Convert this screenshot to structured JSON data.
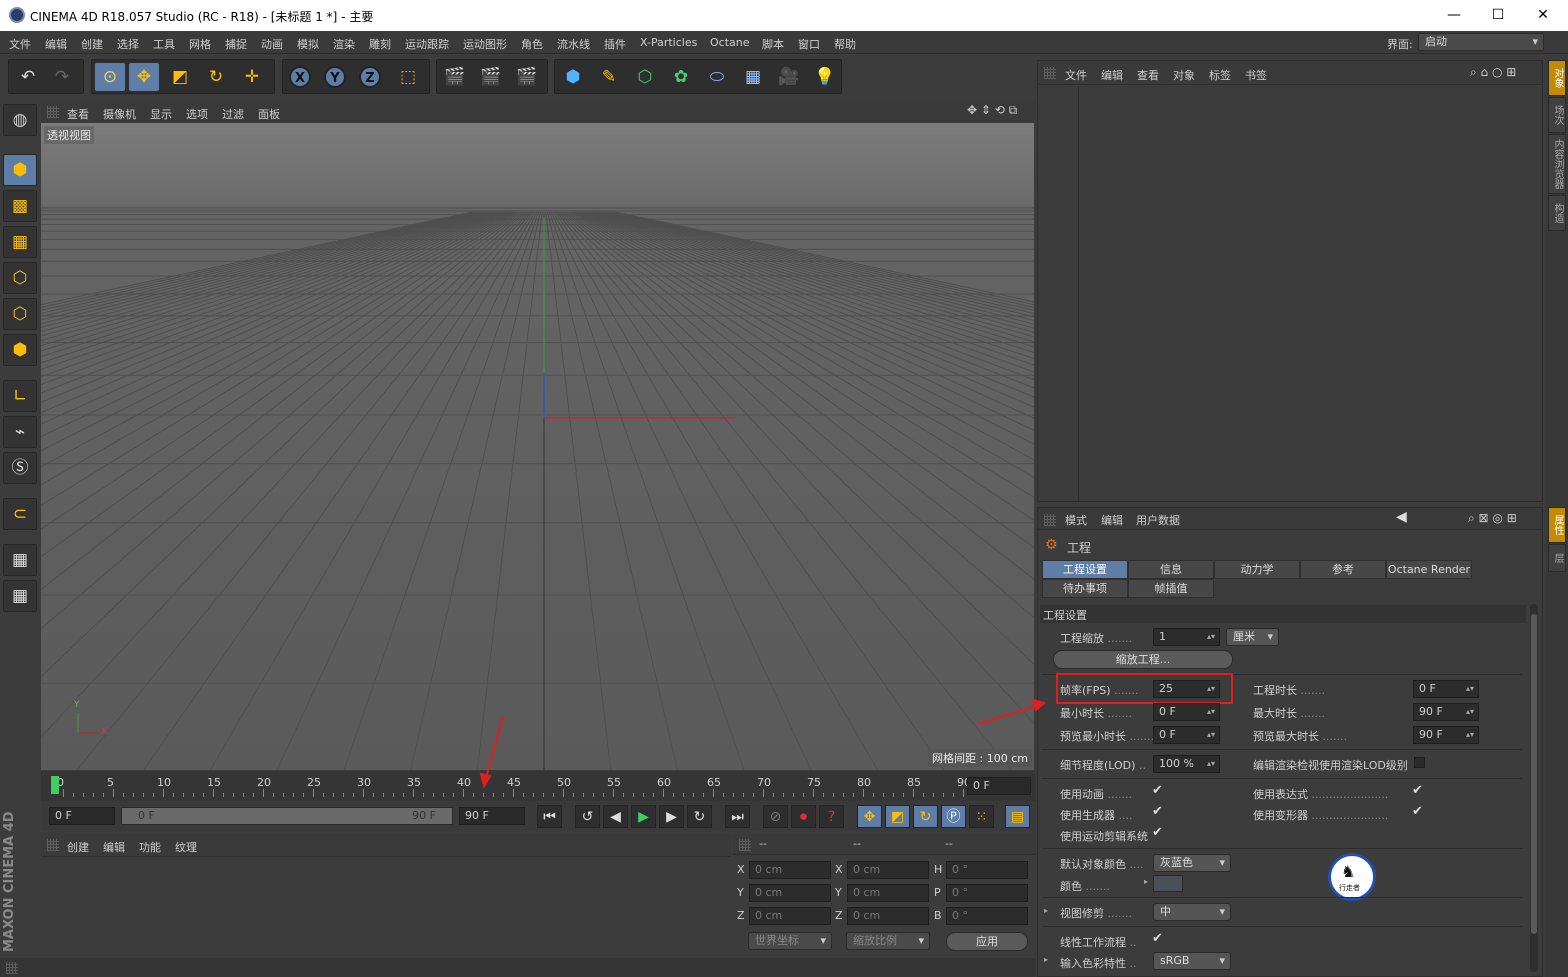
{
  "window": {
    "title": "CINEMA 4D R18.057 Studio (RC - R18) - [未标题 1 *] - 主要",
    "minimize": "—",
    "maximize": "☐",
    "close": "✕"
  },
  "menu": [
    "文件",
    "编辑",
    "创建",
    "选择",
    "工具",
    "网格",
    "捕捉",
    "动画",
    "模拟",
    "渲染",
    "雕刻",
    "运动跟踪",
    "运动图形",
    "角色",
    "流水线",
    "插件",
    "X-Particles",
    "Octane",
    "脚本",
    "窗口",
    "帮助"
  ],
  "layout": {
    "label": "界面:",
    "value": "启动"
  },
  "viewport": {
    "menu": [
      "查看",
      "摄像机",
      "显示",
      "选项",
      "过滤",
      "面板"
    ],
    "label": "透视视图",
    "grid_spacing": "网格间距 : 100 cm",
    "axis_y": "Y",
    "axis_x": "X"
  },
  "timeline": {
    "ticks": [
      "0",
      "5",
      "10",
      "15",
      "20",
      "25",
      "30",
      "35",
      "40",
      "45",
      "50",
      "55",
      "60",
      "65",
      "70",
      "75",
      "80",
      "85",
      "90"
    ],
    "current_frame": "0 F"
  },
  "controls": {
    "start": "0 F",
    "range_start": "0 F",
    "range_end": "90 F",
    "end": "90 F"
  },
  "material_panel": {
    "menu": [
      "创建",
      "编辑",
      "功能",
      "纹理"
    ]
  },
  "coord_panel": {
    "head": [
      "--",
      "--",
      "--"
    ],
    "rows": [
      {
        "a": "X",
        "av": "0 cm",
        "b": "X",
        "bv": "0 cm",
        "c": "H",
        "cv": "0 °"
      },
      {
        "a": "Y",
        "av": "0 cm",
        "b": "Y",
        "bv": "0 cm",
        "c": "P",
        "cv": "0 °"
      },
      {
        "a": "Z",
        "av": "0 cm",
        "b": "Z",
        "bv": "0 cm",
        "c": "B",
        "cv": "0 °"
      }
    ],
    "world": "世界坐标",
    "scale": "缩放比例",
    "apply": "应用"
  },
  "object_panel": {
    "menu": [
      "文件",
      "编辑",
      "查看",
      "对象",
      "标签",
      "书签"
    ]
  },
  "attr_panel": {
    "menu": [
      "模式",
      "编辑",
      "用户数据"
    ],
    "title": "工程",
    "tabs_row1": [
      "工程设置",
      "信息",
      "动力学",
      "参考",
      "Octane Render"
    ],
    "tabs_row2": [
      "待办事项",
      "帧插值"
    ],
    "section": "工程设置",
    "scale_label": "工程缩放",
    "scale_value": "1",
    "scale_unit": "厘米",
    "scale_button": "缩放工程...",
    "fps_label": "帧率(FPS)",
    "fps_value": "25",
    "duration_label": "工程时长",
    "duration_value": "0 F",
    "min_label": "最小时长",
    "min_value": "0 F",
    "max_label": "最大时长",
    "max_value": "90 F",
    "pmin_label": "预览最小时长",
    "pmin_value": "0 F",
    "pmax_label": "预览最大时长",
    "pmax_value": "90 F",
    "lod_label": "细节程度(LOD)",
    "lod_value": "100 %",
    "lod_render_label": "编辑渲染检视使用渲染LOD级别",
    "use_anim": "使用动画",
    "use_expr": "使用表达式",
    "use_gen": "使用生成器",
    "use_deform": "使用变形器",
    "use_motion": "使用运动剪辑系统",
    "def_color_label": "默认对象颜色",
    "def_color_value": "灰蓝色",
    "color_label": "颜色",
    "clip_label": "视图修剪",
    "clip_value": "中",
    "linear_label": "线性工作流程",
    "input_color_label": "输入色彩特性",
    "input_color_value": "sRGB",
    "dots": "......."
  },
  "side_tabs": {
    "right_top": [
      "对象",
      "场次",
      "内容浏览器",
      "构造"
    ],
    "right_bottom": [
      "属性",
      "层"
    ]
  },
  "brand": "MAXON CINEMA 4D",
  "watermark_text": "行走者"
}
